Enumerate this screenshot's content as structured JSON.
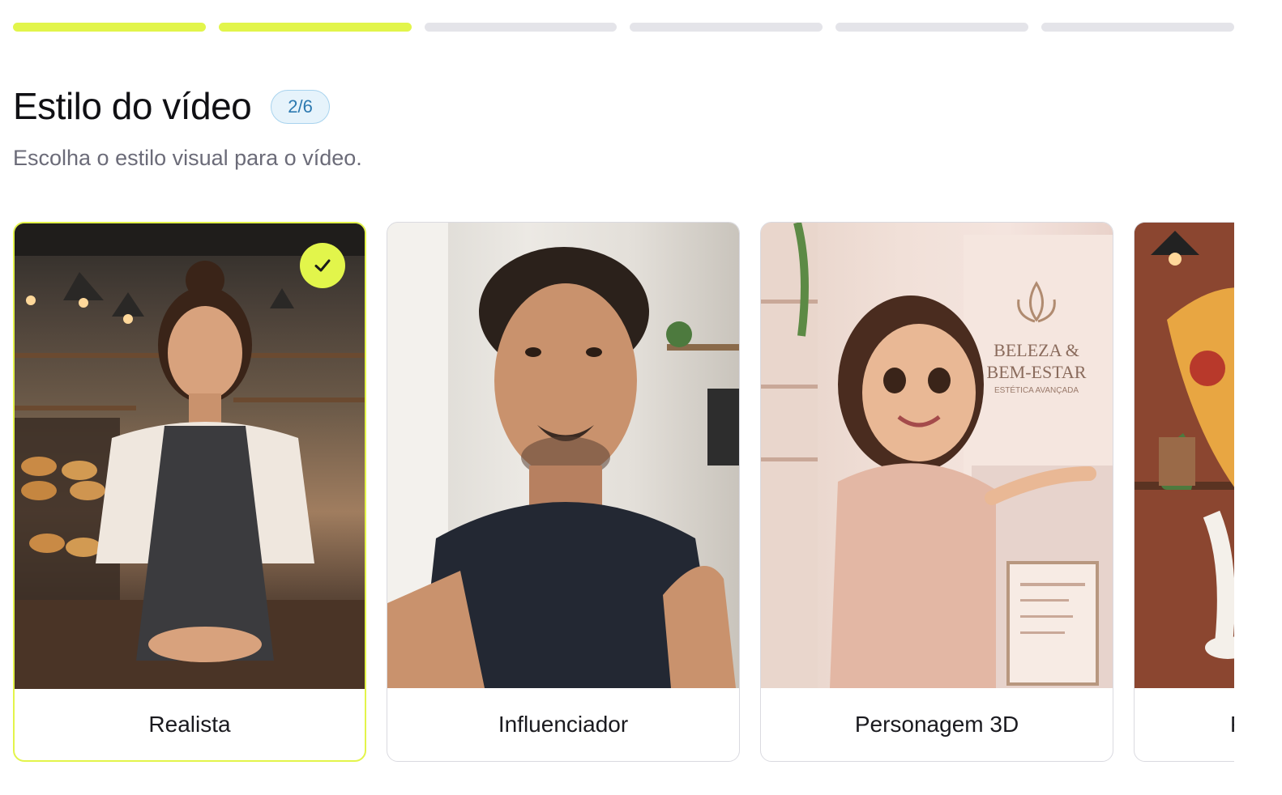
{
  "progress": {
    "total_steps": 6,
    "completed_steps": 2
  },
  "header": {
    "title": "Estilo do vídeo",
    "step_badge": "2/6",
    "subtitle": "Escolha o estilo visual para o vídeo."
  },
  "styles": [
    {
      "label": "Realista",
      "selected": true
    },
    {
      "label": "Influenciador",
      "selected": false
    },
    {
      "label": "Personagem 3D",
      "selected": false
    },
    {
      "label": "P",
      "selected": false
    }
  ],
  "thumb_3d": {
    "sign_line1": "BELEZA &",
    "sign_line2": "BEM-ESTAR",
    "sign_tagline": "ESTÉTICA AVANÇADA"
  },
  "colors": {
    "accent": "#e2f54b",
    "badge_bg": "#e6f3fb",
    "badge_text": "#2c79b0"
  }
}
